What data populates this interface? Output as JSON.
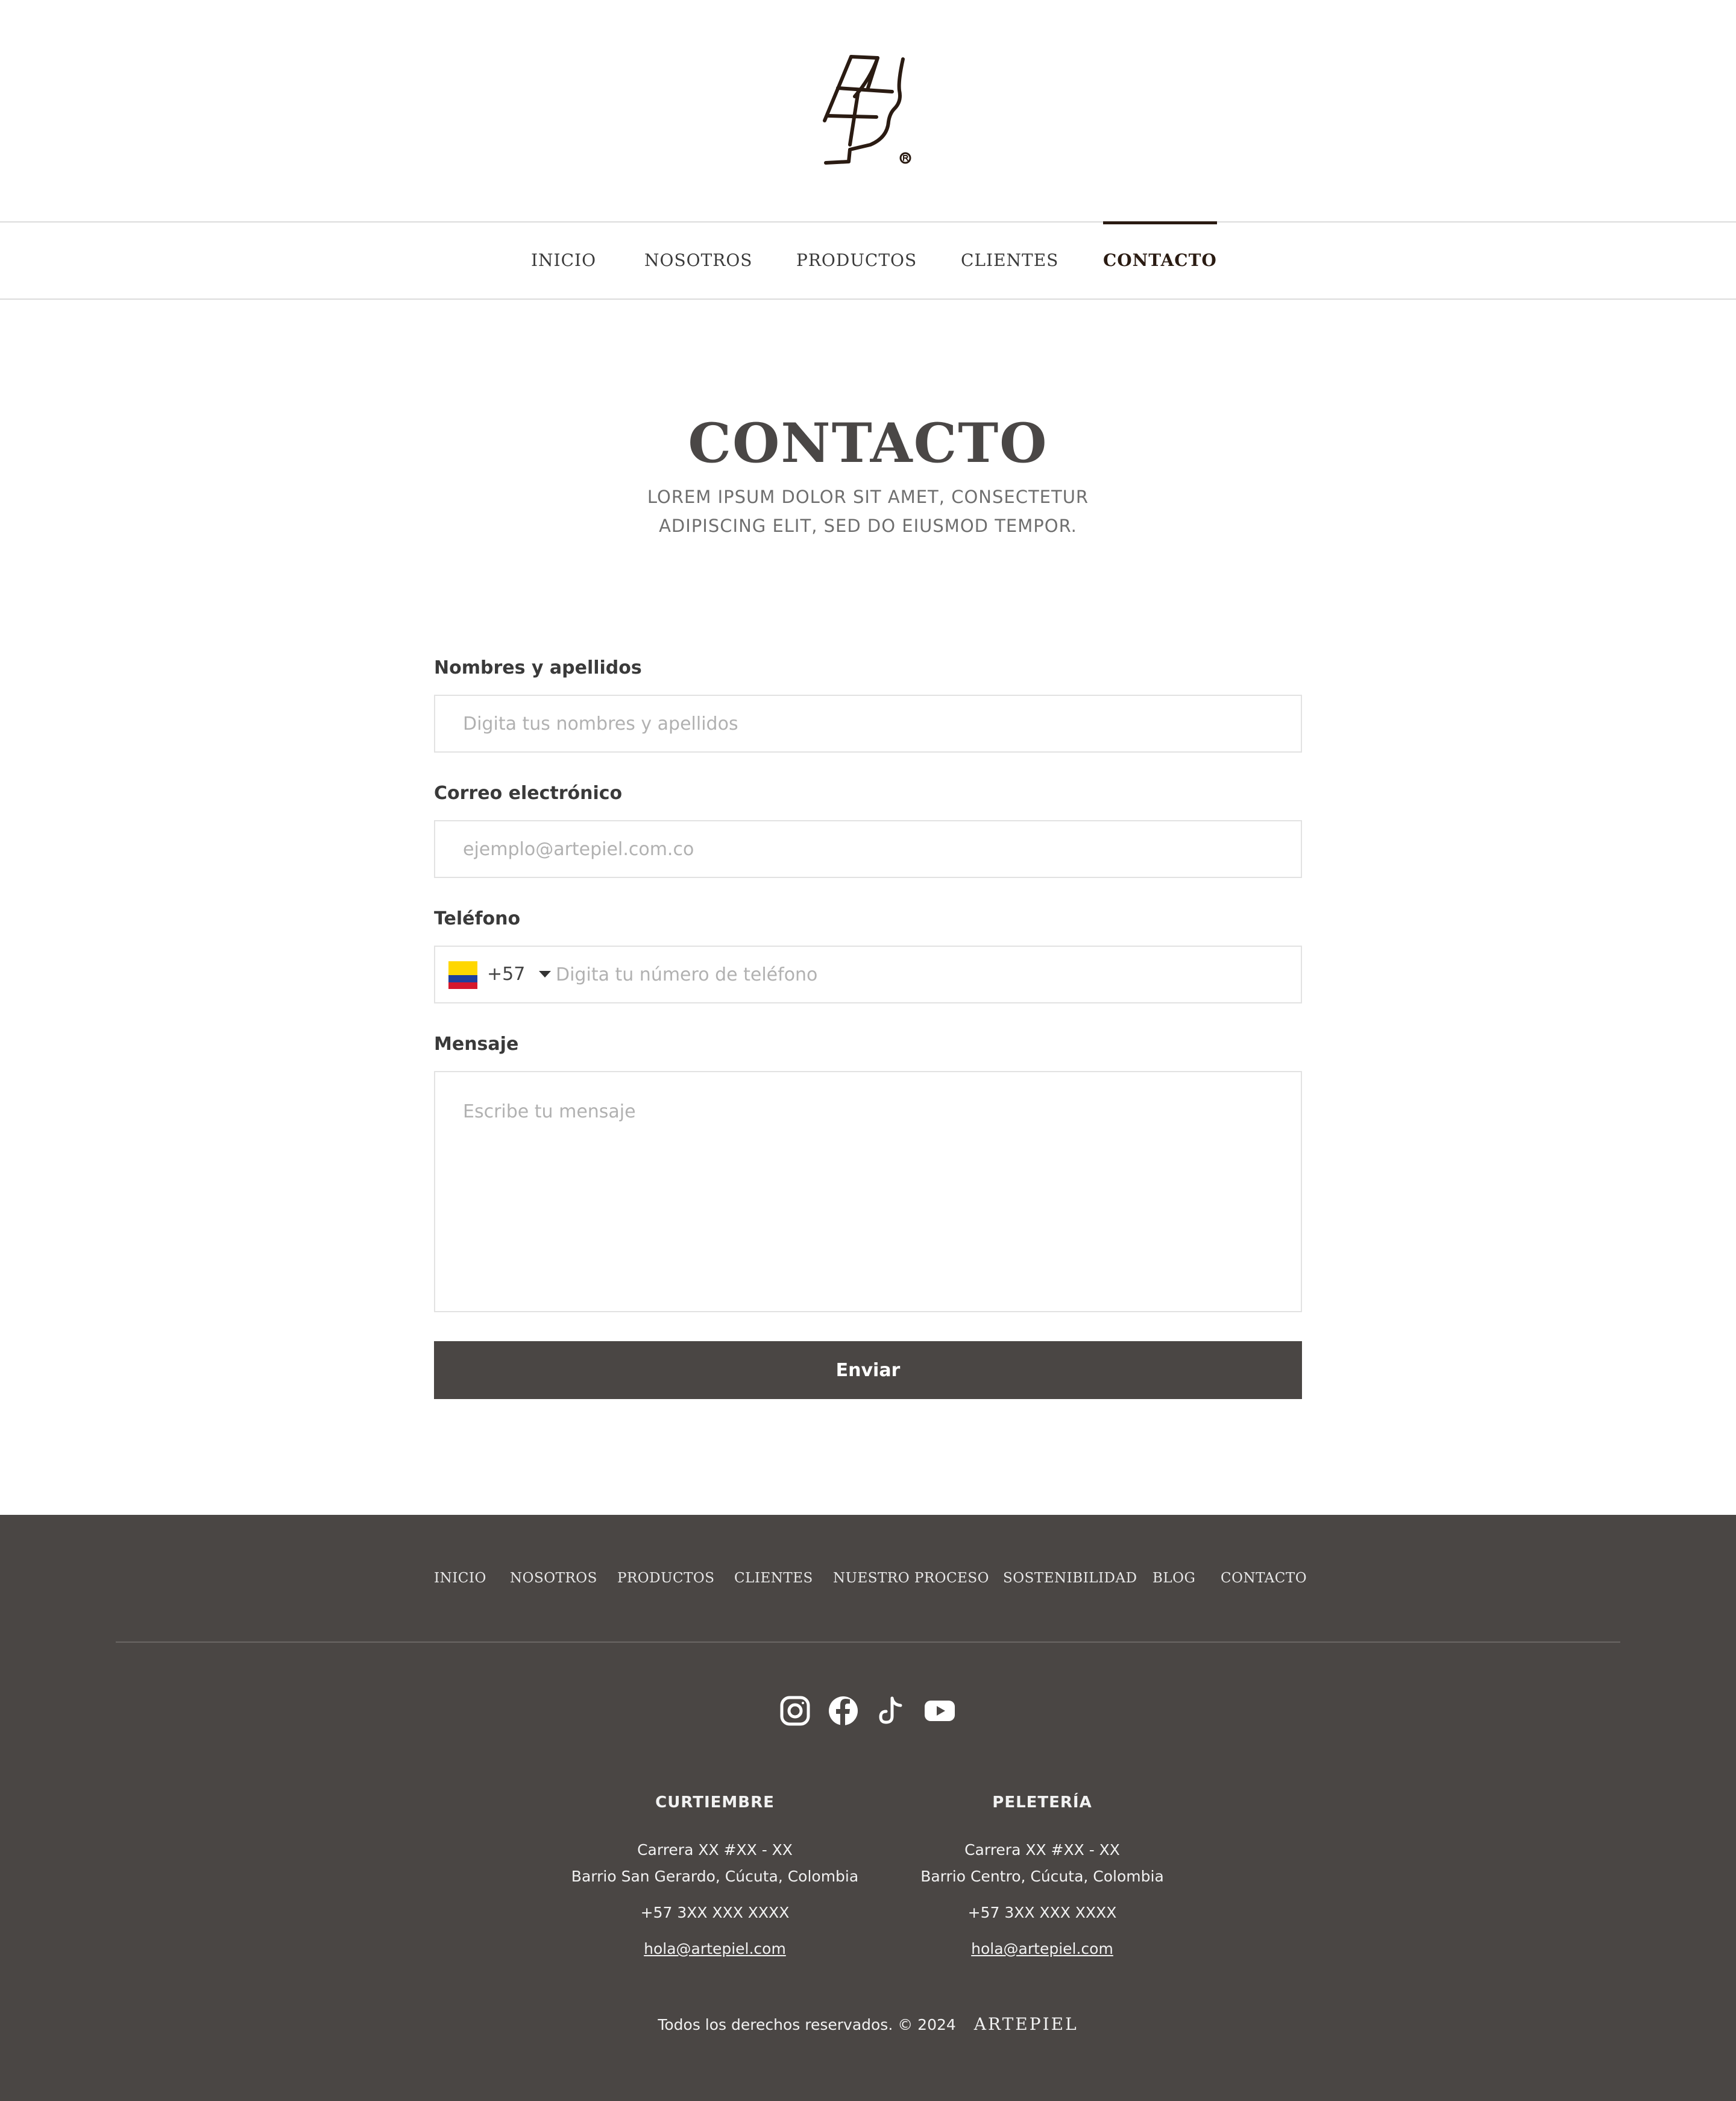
{
  "nav": {
    "items": [
      "INICIO",
      "NOSOTROS",
      "PRODUCTOS",
      "CLIENTES",
      "CONTACTO"
    ],
    "active": "CONTACTO"
  },
  "hero": {
    "title": "CONTACTO",
    "subtitle": "LOREM IPSUM DOLOR SIT AMET, CONSECTETUR ADIPISCING ELIT, SED DO EIUSMOD TEMPOR."
  },
  "form": {
    "name": {
      "label": "Nombres y apellidos",
      "placeholder": "Digita tus nombres y apellidos",
      "value": ""
    },
    "email": {
      "label": "Correo electrónico",
      "placeholder": "ejemplo@artepiel.com.co",
      "value": ""
    },
    "phone": {
      "label": "Teléfono",
      "country_code": "+57",
      "flag": "colombia-flag",
      "placeholder": "Digita tu número de teléfono",
      "value": ""
    },
    "message": {
      "label": "Mensaje",
      "placeholder": "Escribe tu mensaje",
      "value": ""
    },
    "submit_label": "Enviar"
  },
  "footer": {
    "nav": [
      "INICIO",
      "NOSOTROS",
      "PRODUCTOS",
      "CLIENTES",
      "NUESTRO PROCESO",
      "SOSTENIBILIDAD",
      "BLOG",
      "CONTACTO"
    ],
    "social": [
      "instagram-icon",
      "facebook-icon",
      "tiktok-icon",
      "youtube-icon"
    ],
    "columns": [
      {
        "title": "CURTIEMBRE",
        "address_line1": "Carrera XX #XX - XX",
        "address_line2": "Barrio San Gerardo, Cúcuta, Colombia",
        "phone": "+57 3XX XXX XXXX",
        "email": "hola@artepiel.com"
      },
      {
        "title": "PELETERÍA",
        "address_line1": "Carrera XX #XX - XX",
        "address_line2": "Barrio Centro, Cúcuta, Colombia",
        "phone": "+57 3XX XXX XXXX",
        "email": "hola@artepiel.com"
      }
    ],
    "copyright": "Todos los derechos reservados. © 2024",
    "brand": "ARTEPIEL"
  },
  "colors": {
    "dark_bg": "#4a4644",
    "accent": "#2a1b12",
    "border": "#e2e2e2"
  }
}
